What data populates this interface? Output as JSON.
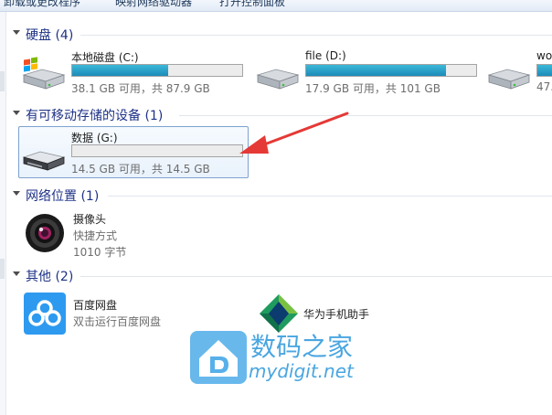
{
  "toolbar": {
    "items": [
      {
        "label": "卸载或更改程序"
      },
      {
        "label": "映射网络驱动器"
      },
      {
        "label": "打开控制面板"
      }
    ]
  },
  "sections": {
    "hdd": {
      "title": "硬盘 (4)"
    },
    "removable": {
      "title": "有可移动存储的设备 (1)"
    },
    "network": {
      "title": "网络位置 (1)"
    },
    "other": {
      "title": "其他 (2)"
    }
  },
  "drives": [
    {
      "name": "本地磁盘 (C:)",
      "space": "38.1 GB 可用，共 87.9 GB",
      "used_fraction": 0.567
    },
    {
      "name": "file (D:)",
      "space": "17.9 GB 可用，共 101 GB",
      "used_fraction": 0.823
    },
    {
      "name": "wo",
      "space": "47."
    }
  ],
  "removable": [
    {
      "name": "数据 (G:)",
      "space": "14.5 GB 可用，共 14.5 GB",
      "used_fraction": 0.0
    }
  ],
  "network": [
    {
      "name": "摄像头",
      "type": "快捷方式",
      "size": "1010 字节"
    }
  ],
  "other": [
    {
      "name": "百度网盘",
      "desc": "双击运行百度网盘"
    },
    {
      "name": "华为手机助手"
    }
  ],
  "watermark": {
    "cn": "数码之家",
    "en": "mydigit.net"
  },
  "colors": {
    "section_title": "#1e3287",
    "bar_fill": "#26a0da",
    "annotation_arrow": "#e53935",
    "watermark": "#4aa6e0"
  }
}
